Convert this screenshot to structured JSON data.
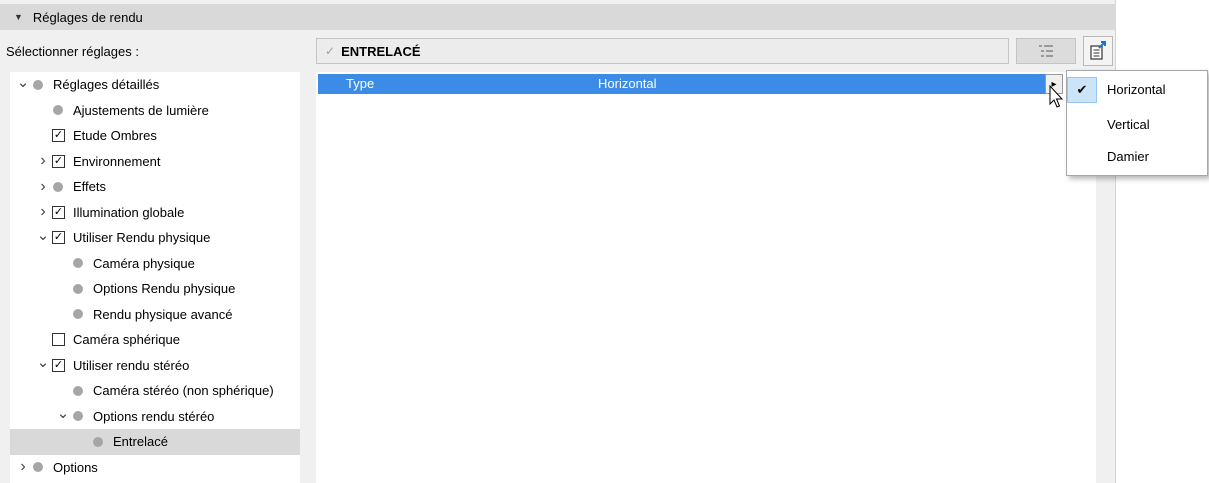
{
  "section": {
    "title": "Réglages de rendu",
    "collapse_icon": "triangle-down-icon"
  },
  "select_label": "Sélectionner réglages :",
  "preset": {
    "check_glyph": "✓",
    "name": "ENTRELACÉ"
  },
  "toolbar": {
    "list_icon": "list-settings-icon",
    "export_icon": "export-settings-icon"
  },
  "tree": {
    "items": [
      {
        "label": "Réglages détaillés",
        "marker": "dot",
        "expander": "expanded",
        "level": 0
      },
      {
        "label": "Ajustements de lumière",
        "marker": "dot",
        "expander": "none",
        "level": 1
      },
      {
        "label": "Etude Ombres",
        "marker": "checked",
        "expander": "none",
        "level": 1
      },
      {
        "label": "Environnement",
        "marker": "checked",
        "expander": "collapsed",
        "level": 1
      },
      {
        "label": "Effets",
        "marker": "dot",
        "expander": "collapsed",
        "level": 1
      },
      {
        "label": "Illumination globale",
        "marker": "checked",
        "expander": "collapsed",
        "level": 1
      },
      {
        "label": "Utiliser Rendu physique",
        "marker": "checked",
        "expander": "expanded",
        "level": 1
      },
      {
        "label": "Caméra physique",
        "marker": "dot",
        "expander": "none",
        "level": 2
      },
      {
        "label": "Options Rendu physique",
        "marker": "dot",
        "expander": "none",
        "level": 2
      },
      {
        "label": "Rendu physique avancé",
        "marker": "dot",
        "expander": "none",
        "level": 2
      },
      {
        "label": "Caméra sphérique",
        "marker": "unchecked",
        "expander": "none",
        "level": 1
      },
      {
        "label": "Utiliser rendu stéréo",
        "marker": "checked",
        "expander": "expanded",
        "level": 1
      },
      {
        "label": "Caméra stéréo (non sphérique)",
        "marker": "dot",
        "expander": "none",
        "level": 2
      },
      {
        "label": "Options rendu stéréo",
        "marker": "dot",
        "expander": "expanded",
        "level": 2
      },
      {
        "label": "Entrelacé",
        "marker": "dot",
        "expander": "none",
        "level": 3,
        "selected": true
      },
      {
        "label": "Options",
        "marker": "dot",
        "expander": "collapsed",
        "level": 0
      }
    ]
  },
  "detail": {
    "row": {
      "key": "Type",
      "value": "Horizontal"
    },
    "dropdown_button_glyph": "▸"
  },
  "dropdown": {
    "selected": "Horizontal",
    "options": [
      "Horizontal",
      "Vertical",
      "Damier"
    ]
  },
  "colors": {
    "selection_blue": "#3c8ce7",
    "check_highlight": "#cce4f7"
  }
}
